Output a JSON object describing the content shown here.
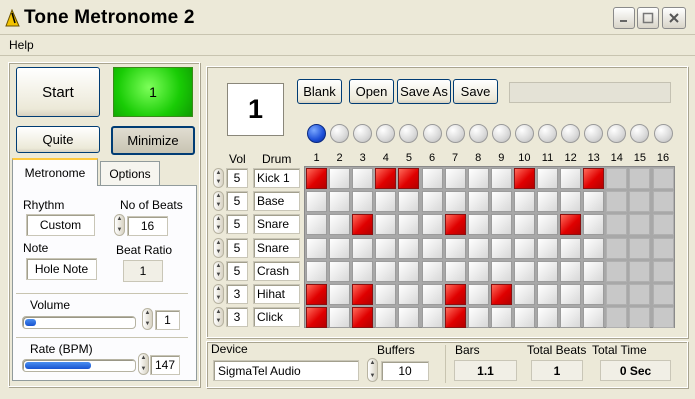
{
  "window": {
    "title": "Tone Metronome 2",
    "minimize_icon": "minimize-icon",
    "maximize_icon": "maximize-icon",
    "close_icon": "close-icon"
  },
  "menu": {
    "help": "Help"
  },
  "controls": {
    "start_label": "Start",
    "beat_display": "1",
    "quite_label": "Quite",
    "minimize_label": "Minimize"
  },
  "tabs": {
    "metronome": "Metronome",
    "options": "Options"
  },
  "metronome": {
    "rhythm_label": "Rhythm",
    "rhythm_value": "Custom",
    "beats_label": "No of Beats",
    "beats_value": "16",
    "note_label": "Note",
    "note_value": "Hole Note",
    "ratio_label": "Beat Ratio",
    "ratio_value": "1",
    "volume_label": "Volume",
    "volume_value": "1",
    "volume_level": 0.1,
    "rate_label": "Rate (BPM)",
    "rate_value": "147",
    "rate_level": 0.6
  },
  "sequencer": {
    "beat_big": "1",
    "blank_label": "Blank",
    "open_label": "Open",
    "saveas_label": "Save As",
    "save_label": "Save",
    "vol_header": "Vol",
    "drum_header": "Drum",
    "active_led": 1,
    "enabled_beats": 13,
    "beat_numbers": [
      "1",
      "2",
      "3",
      "4",
      "5",
      "6",
      "7",
      "8",
      "9",
      "10",
      "11",
      "12",
      "13",
      "14",
      "15",
      "16"
    ],
    "rows": [
      {
        "vol": "5",
        "drum": "Kick 1",
        "pattern": [
          1,
          0,
          0,
          1,
          1,
          0,
          0,
          0,
          0,
          1,
          0,
          0,
          1,
          0,
          0,
          0
        ]
      },
      {
        "vol": "5",
        "drum": "Base",
        "pattern": [
          0,
          0,
          0,
          0,
          0,
          0,
          0,
          0,
          0,
          0,
          0,
          0,
          0,
          0,
          0,
          0
        ]
      },
      {
        "vol": "5",
        "drum": "Snare",
        "pattern": [
          0,
          0,
          1,
          0,
          0,
          0,
          1,
          0,
          0,
          0,
          0,
          1,
          0,
          0,
          0,
          0
        ]
      },
      {
        "vol": "5",
        "drum": "Snare",
        "pattern": [
          0,
          0,
          0,
          0,
          0,
          0,
          0,
          0,
          0,
          0,
          0,
          0,
          0,
          0,
          0,
          0
        ]
      },
      {
        "vol": "5",
        "drum": "Crash",
        "pattern": [
          0,
          0,
          0,
          0,
          0,
          0,
          0,
          0,
          0,
          0,
          0,
          0,
          0,
          0,
          0,
          0
        ]
      },
      {
        "vol": "3",
        "drum": "Hihat",
        "pattern": [
          1,
          0,
          1,
          0,
          0,
          0,
          1,
          0,
          1,
          0,
          0,
          0,
          0,
          0,
          0,
          0
        ]
      },
      {
        "vol": "3",
        "drum": "Click",
        "pattern": [
          1,
          0,
          1,
          0,
          0,
          0,
          1,
          0,
          0,
          0,
          0,
          0,
          0,
          0,
          0,
          0
        ]
      }
    ]
  },
  "footer": {
    "device_label": "Device",
    "device_value": "SigmaTel Audio",
    "buffers_label": "Buffers",
    "buffers_value": "10",
    "bars_label": "Bars",
    "bars_value": "1.1",
    "total_beats_label": "Total Beats",
    "total_beats_value": "1",
    "total_time_label": "Total Time",
    "total_time_value": "0 Sec"
  }
}
